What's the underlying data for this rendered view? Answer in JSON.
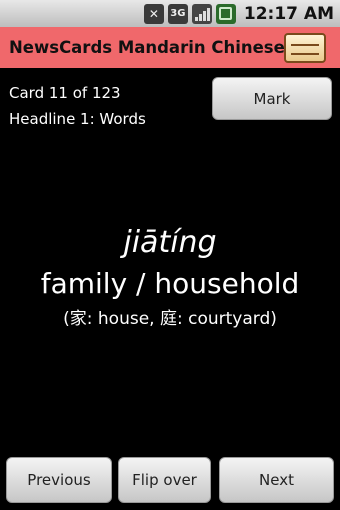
{
  "status_bar": {
    "icons": [
      "mute-icon",
      "3g-data-icon",
      "signal-icon",
      "battery-icon"
    ],
    "data_label": "3G",
    "time": "12:17 AM"
  },
  "title_bar": {
    "title": "NewsCards Mandarin Chinese",
    "logo_icon": "newspaper-icon",
    "accent_color": "#f0686b"
  },
  "card_info": {
    "card_position": "Card 11 of 123",
    "headline": "Headline 1: Words"
  },
  "buttons": {
    "mark": "Mark",
    "previous": "Previous",
    "flip": "Flip over",
    "next": "Next"
  },
  "card": {
    "pinyin": "jiātíng",
    "meaning": "family / household",
    "breakdown": "(家: house, 庭: courtyard)"
  }
}
